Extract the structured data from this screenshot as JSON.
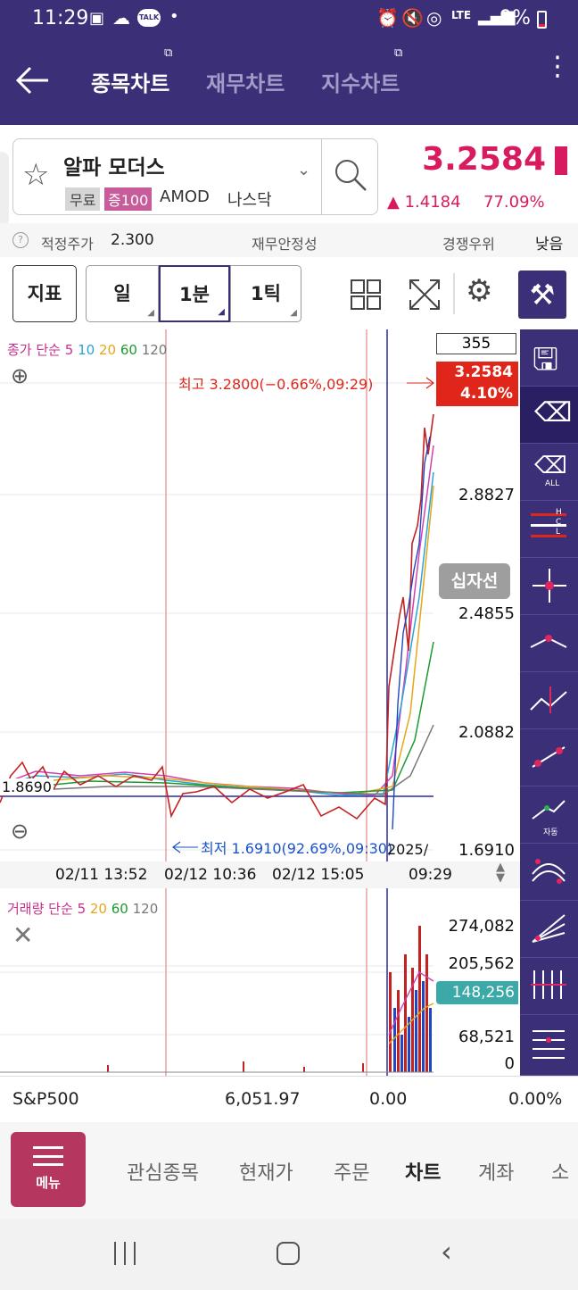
{
  "status": {
    "time": "11:29",
    "battery": "9%",
    "network": "LTE"
  },
  "nav": {
    "tabs": [
      {
        "label": "종목차트",
        "active": true
      },
      {
        "label": "재무차트",
        "active": false
      },
      {
        "label": "지수차트",
        "active": false
      }
    ]
  },
  "stock": {
    "name": "알파 모더스",
    "badge1": "무료",
    "badge2": "증100",
    "code": "AMOD",
    "market": "나스닥",
    "price": "3.2584",
    "change": "▲ 1.4184",
    "change_pct": "77.09%"
  },
  "info": {
    "fair_price_label": "적정주가",
    "fair_price": "2.300",
    "financial_label": "재무안정성",
    "competition_label": "경쟁우위",
    "low_label": "낮음"
  },
  "toolbar": {
    "indicator": "지표",
    "day": "일",
    "minute": "1분",
    "tick": "1틱"
  },
  "chart": {
    "legend": {
      "prefix": "종가 단순",
      "ma": [
        "5",
        "10",
        "20",
        "60",
        "120"
      ]
    },
    "count_box": "355",
    "high_label": "최고 3.2800(−0.66%,09:29)",
    "low_label": "최저 1.6910(92.69%,09:30)",
    "cur_price": "3.2584",
    "cur_pct": "4.10%",
    "crosshair_label": "십자선",
    "left_price": "1.8690",
    "y_ticks": [
      "2.8827",
      "2.4855",
      "2.0882",
      "1.6910"
    ],
    "x_labels": [
      "02/11 13:52",
      "02/12 10:36",
      "02/12 15:05"
    ],
    "x_cursor": "2025/",
    "x_cursor_time": "09:29"
  },
  "volume": {
    "legend": {
      "prefix": "거래량 단순",
      "ma": [
        "5",
        "20",
        "60",
        "120"
      ]
    },
    "y_ticks": [
      "274,082",
      "205,562",
      "68,521",
      "0"
    ],
    "tag": "148,256"
  },
  "index_bar": {
    "name": "S&P500",
    "value": "6,051.97",
    "change": "0.00",
    "pct": "0.00%"
  },
  "bottom_nav": {
    "menu": "메뉴",
    "items": [
      "관심종목",
      "현재가",
      "주문",
      "차트",
      "계좌",
      "소"
    ]
  },
  "colors": {
    "brand": "#3b2f78",
    "up": "#d81b60",
    "pink_btn": "#b5375f",
    "high": "#e0261a",
    "low": "#1a52c7"
  }
}
